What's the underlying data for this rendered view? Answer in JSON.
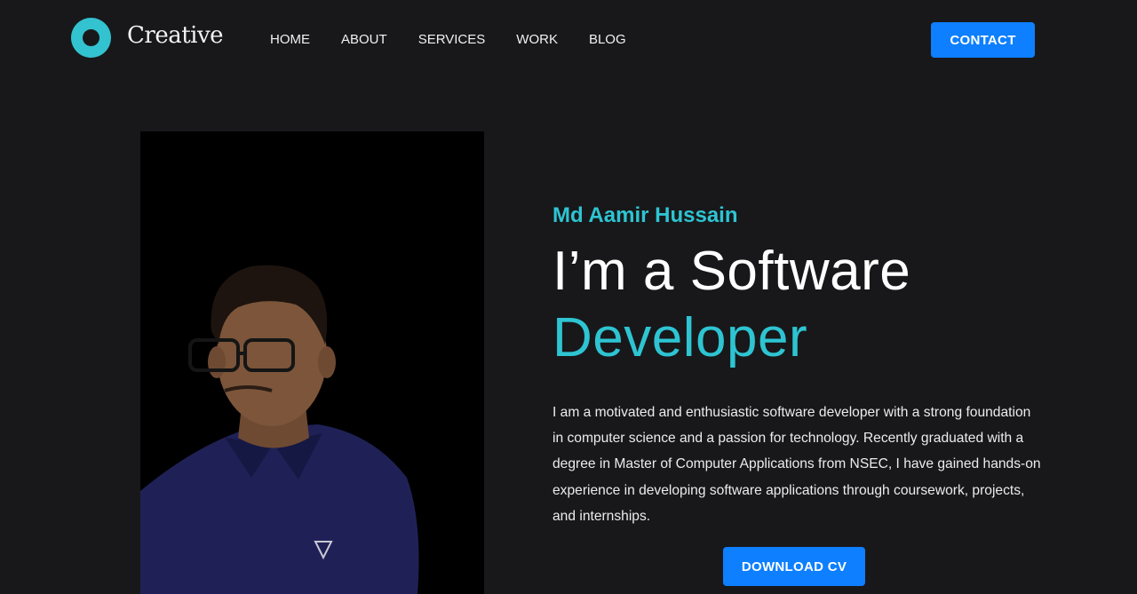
{
  "header": {
    "brand": "Creative",
    "nav": [
      "HOME",
      "ABOUT",
      "SERVICES",
      "WORK",
      "BLOG"
    ],
    "contact_label": "CONTACT"
  },
  "hero": {
    "name": "Md Aamir Hussain",
    "line1": "I’m a Software",
    "line2": "Developer",
    "bio": "I am a motivated and enthusiastic software developer with a strong foundation in computer science and a passion for technology. Recently graduated with a degree in Master of Computer Applications from NSEC, I have gained hands-on experience in developing software applications through coursework, projects, and internships.",
    "download_label": "DOWNLOAD CV"
  },
  "colors": {
    "background": "#18181a",
    "accent": "#2ec4d2",
    "button": "#0d7fff"
  },
  "icons": {
    "logo": "ring-logo-icon",
    "portrait": "profile-photo"
  }
}
